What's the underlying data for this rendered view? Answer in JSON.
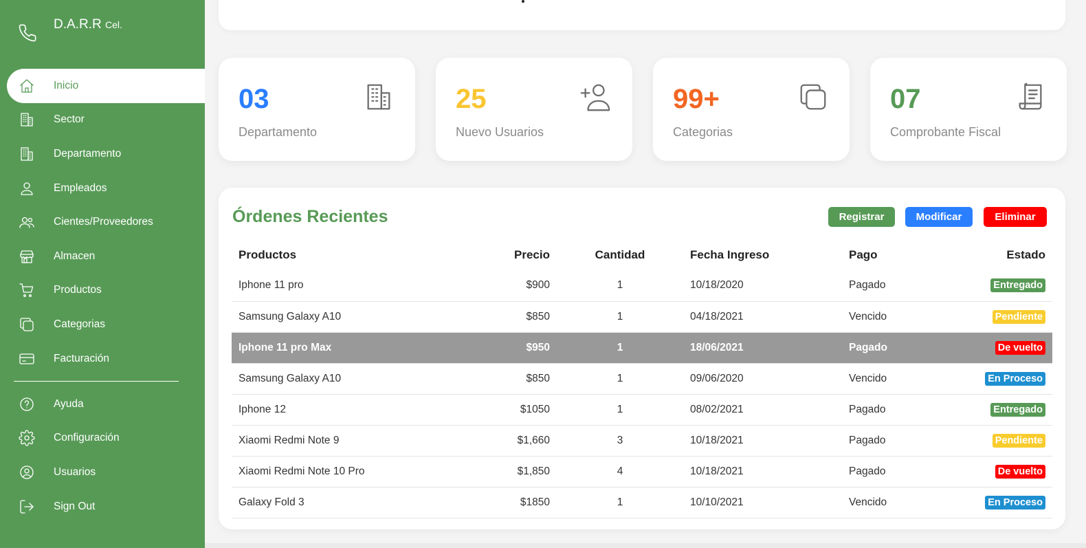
{
  "brand": {
    "name": "D.A.R.R",
    "suffix": "Cel."
  },
  "nav": [
    {
      "label": "Inicio",
      "icon": "home-icon",
      "active": true
    },
    {
      "label": "Sector",
      "icon": "building-icon"
    },
    {
      "label": "Departamento",
      "icon": "building-icon"
    },
    {
      "label": "Empleados",
      "icon": "user-icon"
    },
    {
      "label": "Cientes/Proveedores",
      "icon": "users-icon"
    },
    {
      "label": "Almacen",
      "icon": "store-icon"
    },
    {
      "label": "Productos",
      "icon": "cart-icon"
    },
    {
      "label": "Categorias",
      "icon": "copy-icon"
    },
    {
      "label": "Facturación",
      "icon": "card-icon"
    }
  ],
  "nav_bottom": [
    {
      "label": "Ayuda",
      "icon": "help-icon"
    },
    {
      "label": "Configuración",
      "icon": "gear-icon"
    },
    {
      "label": "Usuarios",
      "icon": "user-circle-icon"
    },
    {
      "label": "Sign Out",
      "icon": "sign-out-icon"
    }
  ],
  "cards": [
    {
      "value": "03",
      "label": "Departamento",
      "color": "#2a7fff",
      "icon": "building-icon"
    },
    {
      "value": "25",
      "label": "Nuevo Usuarios",
      "color": "#f9c531",
      "icon": "add-user-icon"
    },
    {
      "value": "99+",
      "label": "Categorias",
      "color": "#f26522",
      "icon": "copy-icon"
    },
    {
      "value": "07",
      "label": "Comprobante Fiscal",
      "color": "#579a56",
      "icon": "receipt-icon"
    }
  ],
  "orders": {
    "title": "Órdenes Recientes",
    "buttons": {
      "register": "Registrar",
      "modify": "Modificar",
      "delete": "Eliminar"
    },
    "columns": [
      "Productos",
      "Precio",
      "Cantidad",
      "Fecha Ingreso",
      "Pago",
      "Estado"
    ],
    "rows": [
      {
        "product": "Iphone 11 pro",
        "price": "$900",
        "qty": "1",
        "date": "10/18/2020",
        "payment": "Pagado",
        "status": "Entregado",
        "status_type": "ent"
      },
      {
        "product": "Samsung Galaxy A10",
        "price": "$850",
        "qty": "1",
        "date": "04/18/2021",
        "payment": "Vencido",
        "status": "Pendiente",
        "status_type": "pen"
      },
      {
        "product": "Iphone 11 pro Max",
        "price": "$950",
        "qty": "1",
        "date": "18/06/2021",
        "payment": "Pagado",
        "status": "De vuelto",
        "status_type": "dev",
        "highlighted": true
      },
      {
        "product": "Samsung Galaxy A10",
        "price": "$850",
        "qty": "1",
        "date": "09/06/2020",
        "payment": "Vencido",
        "status": "En Proceso",
        "status_type": "pro"
      },
      {
        "product": "Iphone 12",
        "price": "$1050",
        "qty": "1",
        "date": "08/02/2021",
        "payment": "Pagado",
        "status": "Entregado",
        "status_type": "ent"
      },
      {
        "product": "Xiaomi Redmi Note 9",
        "price": "$1,660",
        "qty": "3",
        "date": "10/18/2021",
        "payment": "Pagado",
        "status": "Pendiente",
        "status_type": "pen"
      },
      {
        "product": "Xiaomi Redmi Note 10 Pro",
        "price": "$1,850",
        "qty": "4",
        "date": "10/18/2021",
        "payment": "Pagado",
        "status": "De vuelto",
        "status_type": "dev"
      },
      {
        "product": "Galaxy Fold 3",
        "price": "$1850",
        "qty": "1",
        "date": "10/10/2021",
        "payment": "Vencido",
        "status": "En Proceso",
        "status_type": "pro"
      }
    ]
  }
}
